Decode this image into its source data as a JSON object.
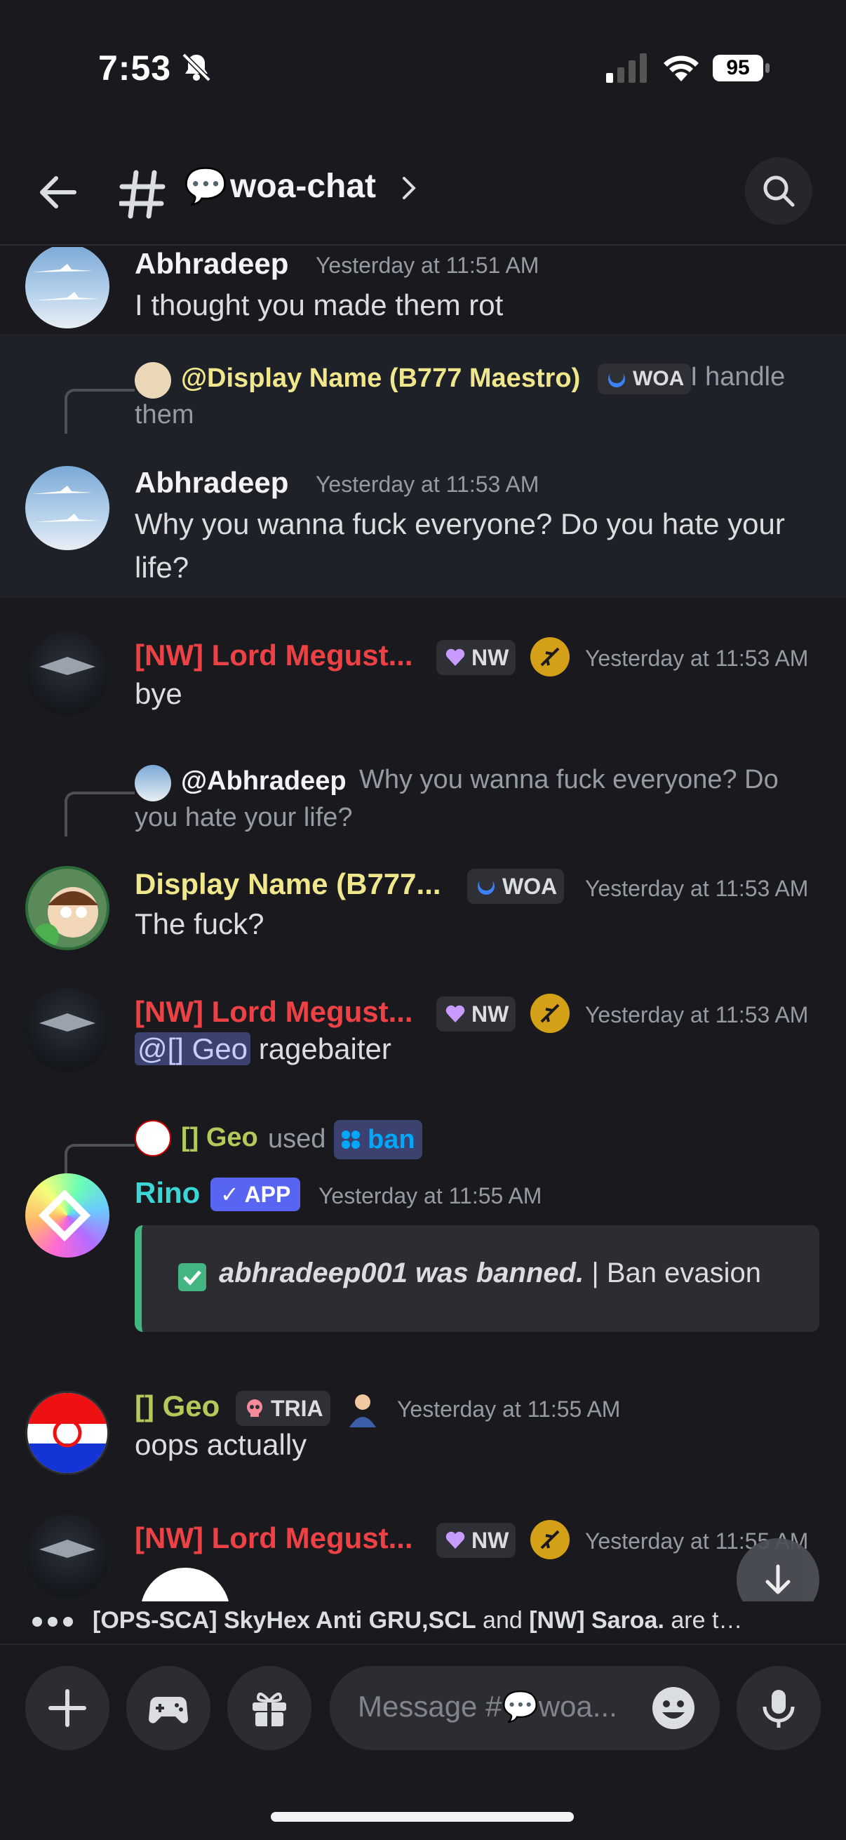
{
  "status_bar": {
    "time": "7:53",
    "battery": "95"
  },
  "header": {
    "channel_emoji": "💬",
    "channel_name": "woa-chat"
  },
  "messages": [
    {
      "author": "Abhradeep",
      "author_color": "#f2f3f5",
      "timestamp": "Yesterday at 11:51 AM",
      "text": "I thought you made them rot"
    },
    {
      "reply": {
        "name": "@Display Name (B777 Maestro)",
        "tag": "WOA",
        "text": "I handle them"
      },
      "author": "Abhradeep",
      "timestamp": "Yesterday at 11:53 AM",
      "text": "Why you wanna fuck everyone? Do you hate your life?"
    },
    {
      "author": "[NW] Lord Megust...",
      "author_color": "#ed4245",
      "tag": "NW",
      "timestamp": "Yesterday at 11:53 AM",
      "text": "bye"
    },
    {
      "reply": {
        "name": "@Abhradeep",
        "text": "Why you wanna fuck everyone? Do you hate your life?"
      },
      "author": "Display Name (B777...",
      "author_color": "#f0e68c",
      "tag": "WOA",
      "timestamp": "Yesterday at 11:53 AM",
      "text": "The fuck?"
    },
    {
      "author": "[NW] Lord Megust...",
      "tag": "NW",
      "timestamp": "Yesterday at 11:53 AM",
      "mention": "@[] Geo",
      "text": "ragebaiter"
    },
    {
      "command": {
        "user": "[] Geo",
        "verb": "used",
        "command": "ban"
      },
      "author": "Rino",
      "author_color": "#3bd6d6",
      "badge": "✓ APP",
      "timestamp": "Yesterday at 11:55 AM",
      "embed": {
        "bold": "abhradeep001 was banned.",
        "rest": "| Ban evasion"
      }
    },
    {
      "author": "[] Geo",
      "author_color": "#b5c95a",
      "tag": "TRIA",
      "timestamp": "Yesterday at 11:55 AM",
      "text": "oops actually"
    },
    {
      "author": "[NW] Lord Megust...",
      "tag": "NW",
      "timestamp": "Yesterday at 11:55 AM"
    }
  ],
  "typing": {
    "users": "[OPS-SCA] SkyHex Anti GRU,SCL",
    "and": "and",
    "others": "[NW] Saroa.",
    "suffix": "are typi..."
  },
  "composer": {
    "placeholder": "Message #💬woa..."
  },
  "colors": {
    "background": "#1a1a1e",
    "accent": "#5865f2",
    "success": "#43b581"
  }
}
